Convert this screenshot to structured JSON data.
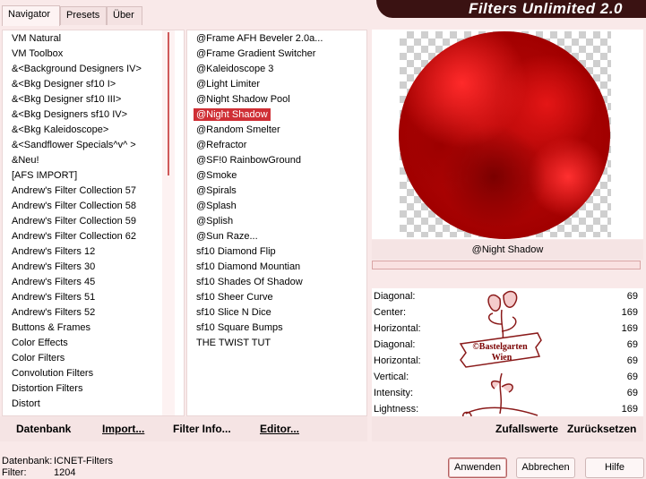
{
  "header": {
    "tabs": [
      {
        "label": "Navigator"
      },
      {
        "label": "Presets"
      },
      {
        "label": "Über"
      }
    ],
    "title": "Filters Unlimited 2.0"
  },
  "categories": [
    "VM Natural",
    "VM Toolbox",
    "&<Background Designers IV>",
    "&<Bkg Designer sf10 I>",
    "&<Bkg Designer sf10 III>",
    "&<Bkg Designers sf10 IV>",
    "&<Bkg Kaleidoscope>",
    "&<Sandflower Specials^v^ >",
    "&Neu!",
    "[AFS IMPORT]",
    "Andrew's Filter Collection 57",
    "Andrew's Filter Collection 58",
    "Andrew's Filter Collection 59",
    "Andrew's Filter Collection 62",
    "Andrew's Filters 12",
    "Andrew's Filters 30",
    "Andrew's Filters 45",
    "Andrew's Filters 51",
    "Andrew's Filters 52",
    "Buttons & Frames",
    "Color Effects",
    "Color Filters",
    "Convolution Filters",
    "Distortion Filters",
    "Distort"
  ],
  "filters": [
    "@Frame AFH Beveler 2.0a...",
    "@Frame Gradient Switcher",
    "@Kaleidoscope 3",
    "@Light Limiter",
    "@Night Shadow Pool",
    "@Night Shadow",
    "@Random Smelter",
    "@Refractor",
    "@SF!0 RainbowGround",
    "@Smoke",
    "@Spirals",
    "@Splash",
    "@Splish",
    "@Sun Raze...",
    "sf10 Diamond Flip",
    "sf10 Diamond Mountian",
    "sf10 Shades Of Shadow",
    "sf10 Sheer Curve",
    "sf10 Slice N Dice",
    "sf10 Square Bumps",
    "THE TWIST TUT"
  ],
  "selected_filter_index": 5,
  "list_buttons": {
    "database": "Datenbank",
    "import": "Import...",
    "filter_info": "Filter Info...",
    "editor": "Editor..."
  },
  "preview": {
    "filter_name": "@Night Shadow"
  },
  "params": [
    {
      "label": "Diagonal:",
      "value": "69"
    },
    {
      "label": "Center:",
      "value": "169"
    },
    {
      "label": "Horizontal:",
      "value": "169"
    },
    {
      "label": "Diagonal:",
      "value": "69"
    },
    {
      "label": "Horizontal:",
      "value": "69"
    },
    {
      "label": "Vertical:",
      "value": "69"
    },
    {
      "label": "Intensity:",
      "value": "69"
    },
    {
      "label": "Lightness:",
      "value": "169"
    }
  ],
  "watermark": {
    "line1": "©Bastelgarten",
    "line2": "Wien"
  },
  "param_buttons": {
    "random": "Zufallswerte",
    "reset": "Zurücksetzen"
  },
  "status": {
    "db_label": "Datenbank:",
    "db_value": "ICNET-Filters",
    "filter_label": "Filter:",
    "filter_value": "1204"
  },
  "dialog_buttons": {
    "apply": "Anwenden",
    "cancel": "Abbrechen",
    "help": "Hilfe"
  },
  "colors": {
    "accent": "#cf2f35",
    "banner": "#3a1212",
    "background": "#f9e9e9"
  }
}
